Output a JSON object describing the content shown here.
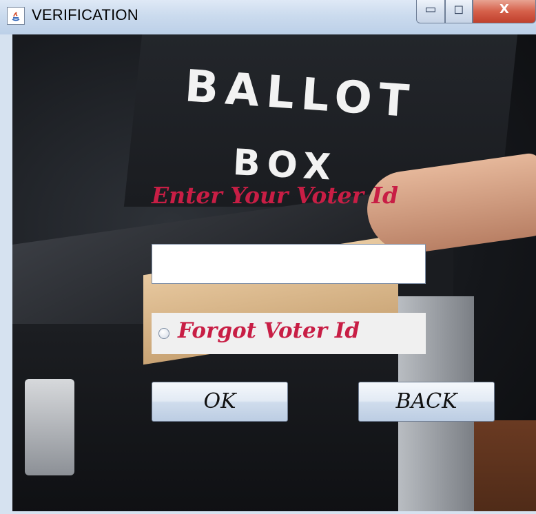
{
  "window": {
    "title": "VERIFICATION",
    "controls": {
      "minimize": "▭",
      "maximize": "◻",
      "close": "X"
    }
  },
  "background": {
    "lid_line1": "BALLOT",
    "lid_line2": "BOX"
  },
  "form": {
    "prompt": "Enter Your Voter Id",
    "voter_id_value": "",
    "forgot_label": "Forgot Voter Id",
    "forgot_selected": false
  },
  "buttons": {
    "ok": "OK",
    "back": "BACK"
  },
  "colors": {
    "label_red": "#c81e45"
  }
}
